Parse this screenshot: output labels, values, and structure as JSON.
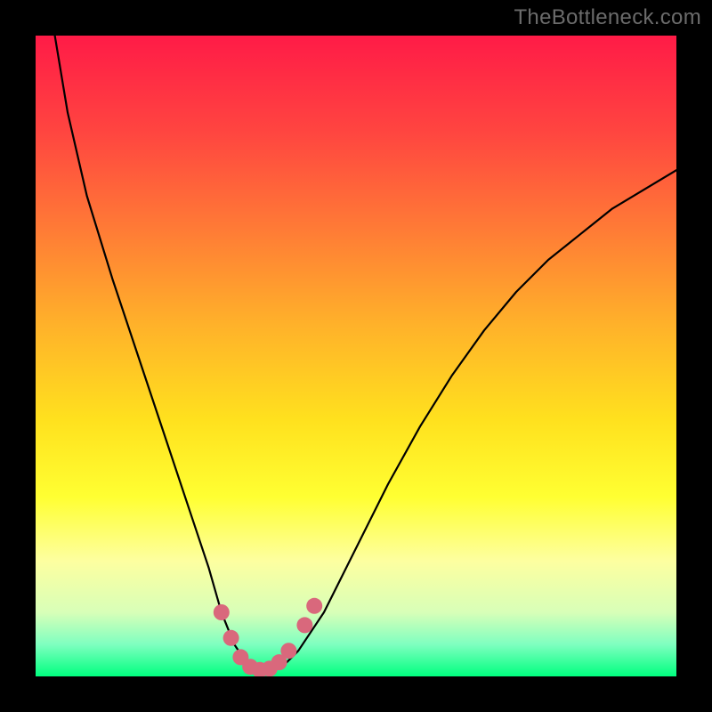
{
  "watermark": "TheBottleneck.com",
  "chart_data": {
    "type": "line",
    "title": "",
    "xlabel": "",
    "ylabel": "",
    "xlim": [
      0,
      100
    ],
    "ylim": [
      0,
      100
    ],
    "series": [
      {
        "name": "bottleneck-curve",
        "x": [
          3,
          5,
          8,
          12,
          16,
          20,
          24,
          27,
          29,
          31,
          33,
          35,
          37,
          39,
          41,
          45,
          50,
          55,
          60,
          65,
          70,
          75,
          80,
          85,
          90,
          95,
          100
        ],
        "y": [
          100,
          88,
          75,
          62,
          50,
          38,
          26,
          17,
          10,
          5,
          2,
          1,
          1,
          2,
          4,
          10,
          20,
          30,
          39,
          47,
          54,
          60,
          65,
          69,
          73,
          76,
          79
        ]
      }
    ],
    "markers": {
      "name": "highlight-band",
      "color": "#d9687c",
      "points": [
        {
          "x": 29,
          "y": 10
        },
        {
          "x": 30.5,
          "y": 6
        },
        {
          "x": 32,
          "y": 3
        },
        {
          "x": 33.5,
          "y": 1.5
        },
        {
          "x": 35,
          "y": 1
        },
        {
          "x": 36.5,
          "y": 1.2
        },
        {
          "x": 38,
          "y": 2.2
        },
        {
          "x": 39.5,
          "y": 4
        },
        {
          "x": 42,
          "y": 8
        },
        {
          "x": 43.5,
          "y": 11
        }
      ]
    }
  }
}
